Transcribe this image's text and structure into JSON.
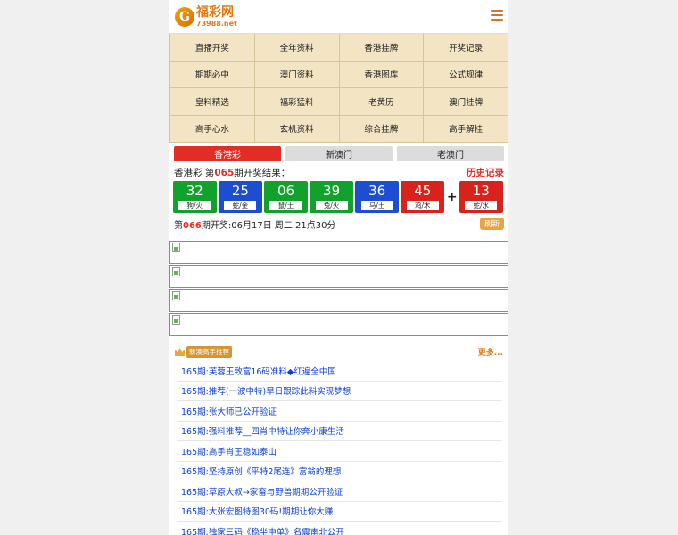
{
  "header": {
    "logo_title": "福彩网",
    "logo_domain": "73988.net",
    "logo_mark": "G"
  },
  "nav_grid": [
    "直播开奖",
    "全年资料",
    "香港挂牌",
    "开奖记录",
    "期期必中",
    "澳门资料",
    "香港图库",
    "公式规律",
    "皇料精选",
    "福彩猛料",
    "老黄历",
    "澳门挂牌",
    "高手心水",
    "玄机资料",
    "综合挂牌",
    "高手解挂"
  ],
  "tabs": [
    "香港彩",
    "新澳门",
    "老澳门"
  ],
  "result": {
    "prefix": "香港彩 第",
    "issue": "065",
    "suffix": "期开奖结果：",
    "history_label": "历史记录"
  },
  "balls": [
    {
      "num": "32",
      "zodiac": "狗/火",
      "color": "green"
    },
    {
      "num": "25",
      "zodiac": "蛇/金",
      "color": "blue"
    },
    {
      "num": "06",
      "zodiac": "鼠/土",
      "color": "green"
    },
    {
      "num": "39",
      "zodiac": "兔/火",
      "color": "green"
    },
    {
      "num": "36",
      "zodiac": "马/土",
      "color": "blue"
    },
    {
      "num": "45",
      "zodiac": "鸡/木",
      "color": "red"
    }
  ],
  "special_ball": {
    "num": "13",
    "zodiac": "蛇/水",
    "color": "red"
  },
  "plus_sign": "+",
  "next_draw": {
    "prefix": "第",
    "issue": "066",
    "suffix": "期开奖:06月17日 周二 21点30分",
    "refresh_label": "刷新"
  },
  "news": {
    "badge": "新澳高手推荐",
    "more_label": "更多...",
    "items": [
      "165期:芙蓉王致富16码准料◆红遍全中国",
      "165期:推荐(一波中特)早日跟踪此料实现梦想",
      "165期:张大师已公开验证",
      "165期:强料推荐__四肖中特让你奔小康生活",
      "165期:高手肖王稳如泰山",
      "165期:坚持原创《平特2尾连》富翁的理想",
      "165期:草原大叔→家畜与野兽期期公开验证",
      "165期:大张宏图特图30码!期期让你大赚",
      "165期:独家三码《稳坐中单》名震南北公开"
    ]
  },
  "colors": {
    "accent_red": "#e22c26",
    "accent_orange": "#e5790f",
    "grid_bg": "#f3e5c4",
    "ball_green": "#12a12c",
    "ball_blue": "#1d4ed2",
    "ball_red": "#d8221c",
    "news_link": "#0c3fd6"
  }
}
